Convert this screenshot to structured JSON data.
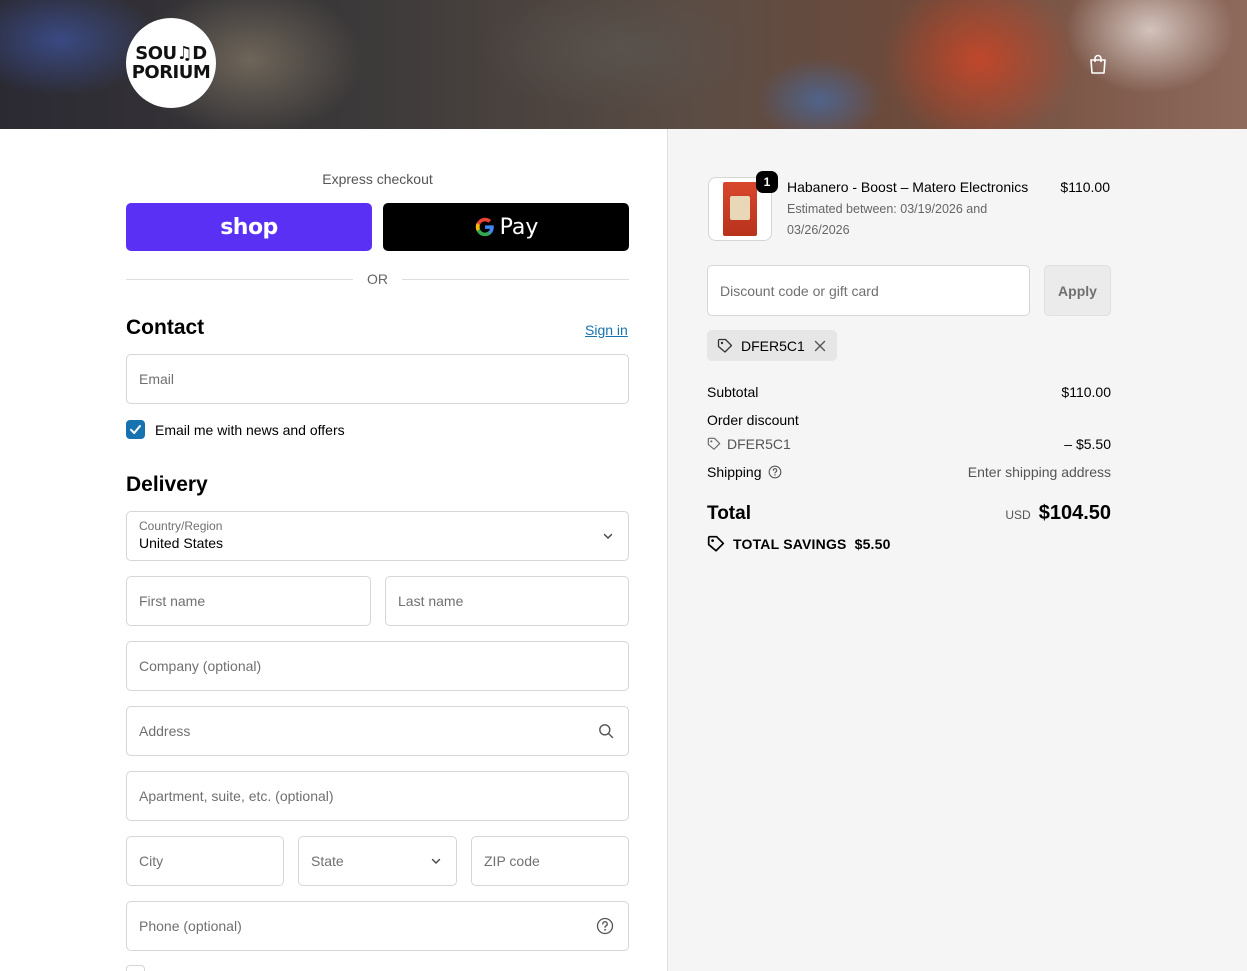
{
  "header": {
    "logo_line1": "SOU♫D",
    "logo_line2": "PORIUM"
  },
  "express": {
    "title": "Express checkout",
    "shop_label": "shop",
    "gpay_label": "Pay",
    "or_label": "OR"
  },
  "contact": {
    "title": "Contact",
    "signin_label": "Sign in",
    "email_placeholder": "Email",
    "newsletter_label": "Email me with news and offers",
    "newsletter_checked": true
  },
  "delivery": {
    "title": "Delivery",
    "country_label": "Country/Region",
    "country_value": "United States",
    "first_name_placeholder": "First name",
    "last_name_placeholder": "Last name",
    "company_placeholder": "Company (optional)",
    "address_placeholder": "Address",
    "apartment_placeholder": "Apartment, suite, etc. (optional)",
    "city_placeholder": "City",
    "state_placeholder": "State",
    "zip_placeholder": "ZIP code",
    "phone_placeholder": "Phone (optional)"
  },
  "summary": {
    "product": {
      "quantity": "1",
      "name": "Habanero - Boost – Matero Electronics",
      "eta": "Estimated between: 03/19/2026 and 03/26/2026",
      "price": "$110.00"
    },
    "discount_placeholder": "Discount code or gift card",
    "apply_label": "Apply",
    "applied_code": "DFER5C1",
    "subtotal_label": "Subtotal",
    "subtotal_value": "$110.00",
    "order_discount_label": "Order discount",
    "order_discount_code": "DFER5C1",
    "order_discount_value": "– $5.50",
    "shipping_label": "Shipping",
    "shipping_value": "Enter shipping address",
    "total_label": "Total",
    "total_currency": "USD",
    "total_value": "$104.50",
    "savings_label": "TOTAL SAVINGS",
    "savings_value": "$5.50"
  },
  "colors": {
    "shop_purple": "#5a31f4",
    "link_blue": "#1773b0"
  }
}
